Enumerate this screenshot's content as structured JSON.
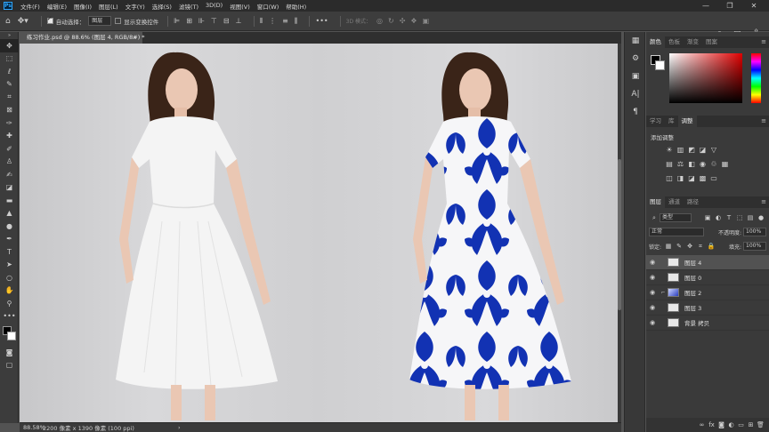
{
  "app": {
    "logo": "Ps"
  },
  "menu": [
    "文件(F)",
    "编辑(E)",
    "图像(I)",
    "图层(L)",
    "文字(Y)",
    "选择(S)",
    "滤镜(T)",
    "3D(D)",
    "视图(V)",
    "窗口(W)",
    "帮助(H)"
  ],
  "window_controls": {
    "minimize": "—",
    "maximize": "❐",
    "close": "✕"
  },
  "options": {
    "auto_select_label": "自动选择：",
    "auto_select_value": "图层",
    "show_transform_label": "显示变换控件",
    "mode_3d_label": "3D 模式：",
    "more": "•••"
  },
  "document": {
    "tab_title": "练习作业.psd @ 88.6% (图层 4, RGB/8#) *",
    "close": "×"
  },
  "status": {
    "zoom": "88.58%",
    "size": "2200 像素 x 1390 像素 (100 ppi)",
    "arrow": "›"
  },
  "color_panel": {
    "tabs": [
      "颜色",
      "色板",
      "渐变",
      "图案"
    ],
    "active": 0
  },
  "learn_panel": {
    "tabs": [
      "学习",
      "库",
      "调整"
    ],
    "active": 2,
    "title": "添加调整"
  },
  "layers_panel": {
    "tabs": [
      "图层",
      "通道",
      "路径"
    ],
    "active": 0,
    "filter_value": "类型",
    "blend_mode": "正常",
    "opacity_label": "不透明度:",
    "opacity_value": "100%",
    "lock_label": "锁定:",
    "fill_label": "填充:",
    "fill_value": "100%",
    "layers": [
      {
        "name": "图层 4",
        "selected": true,
        "thumb": "plain",
        "linked": false
      },
      {
        "name": "图层 0",
        "selected": false,
        "thumb": "plain",
        "linked": false
      },
      {
        "name": "图层 2",
        "selected": false,
        "thumb": "blue",
        "linked": true
      },
      {
        "name": "图层 3",
        "selected": false,
        "thumb": "plain",
        "linked": false
      },
      {
        "name": "背景 拷贝",
        "selected": false,
        "thumb": "plain",
        "linked": false
      }
    ]
  },
  "colors": {
    "accent_blue": "#1232b3",
    "dress_white": "#f4f4f4",
    "canvas_bg": "#d2d2d4",
    "hue_red": "#e00000"
  }
}
